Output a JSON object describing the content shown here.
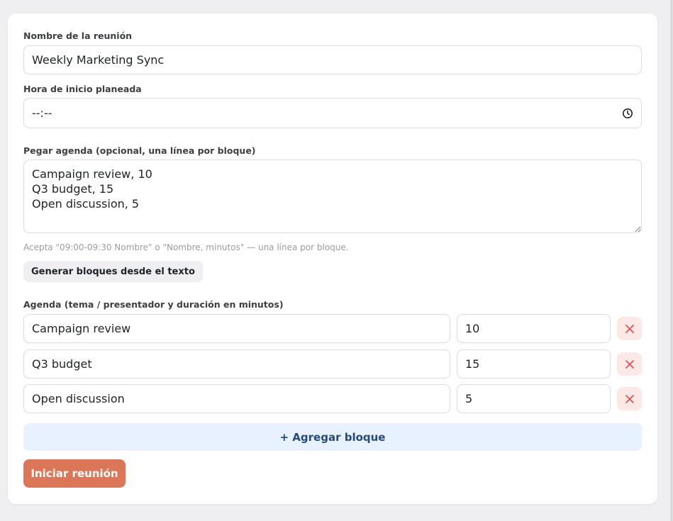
{
  "form": {
    "name_label": "Nombre de la reunión",
    "name_value": "Weekly Marketing Sync",
    "start_label": "Hora de inicio planeada",
    "start_value": "--:--",
    "paste_label": "Pegar agenda (opcional, una línea por bloque)",
    "paste_value": "Campaign review, 10\nQ3 budget, 15\nOpen discussion, 5",
    "paste_hint": "Acepta \"09:00-09:30 Nombre\" o \"Nombre, minutos\" — una línea por bloque.",
    "generate_label": "Generar bloques desde el texto",
    "agenda_label": "Agenda (tema / presentador y duración en minutos)"
  },
  "agenda": [
    {
      "topic": "Campaign review",
      "minutes": "10"
    },
    {
      "topic": "Q3 budget",
      "minutes": "15"
    },
    {
      "topic": "Open discussion",
      "minutes": "5"
    }
  ],
  "actions": {
    "add_label": "+ Agregar bloque",
    "start_label": "Iniciar reunión"
  },
  "colors": {
    "start_button": "#db7658",
    "add_button_bg": "#e7f1ff",
    "delete_button_bg": "#fde8e8",
    "delete_icon": "#d9534f"
  },
  "icons": {
    "time": "clock-icon",
    "delete": "close-icon"
  }
}
